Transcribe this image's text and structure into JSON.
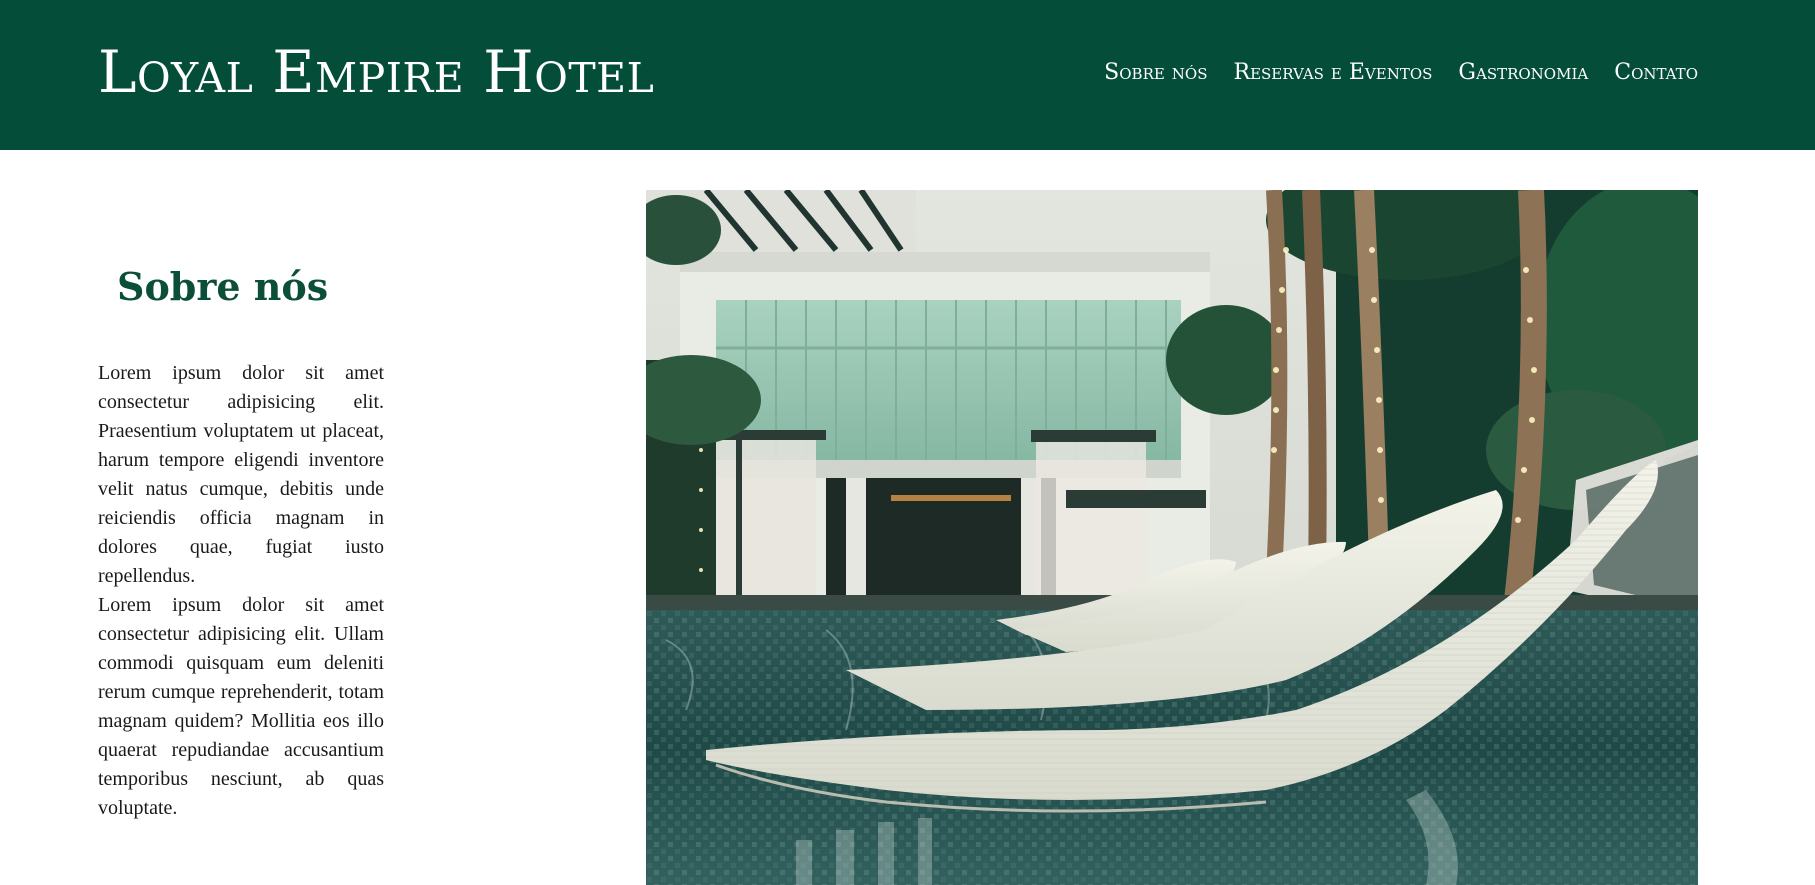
{
  "header": {
    "brand": "Loyal Empire Hotel",
    "nav": [
      {
        "label": "Sobre nós"
      },
      {
        "label": "Reservas e Eventos"
      },
      {
        "label": "Gastronomia"
      },
      {
        "label": "Contato"
      }
    ],
    "background_color": "#044d38"
  },
  "about": {
    "title": "Sobre nós",
    "paragraphs": [
      "Lorem ipsum dolor sit amet consectetur adipisicing elit. Praesentium voluptatem ut placeat, harum tempore eligendi inventore velit natus cumque, debitis unde reiciendis officia magnam in dolores quae, fugiat iusto repellendus.",
      "Lorem ipsum dolor sit amet consectetur adipisicing elit. Ullam commodi quisquam eum deleniti rerum cumque reprehenderit, totam magnam quidem? Mollitia eos illo quaerat repudiandae accusantium temporibus nesciunt, ab quas voluptate."
    ],
    "title_color": "#0b4f3a"
  }
}
